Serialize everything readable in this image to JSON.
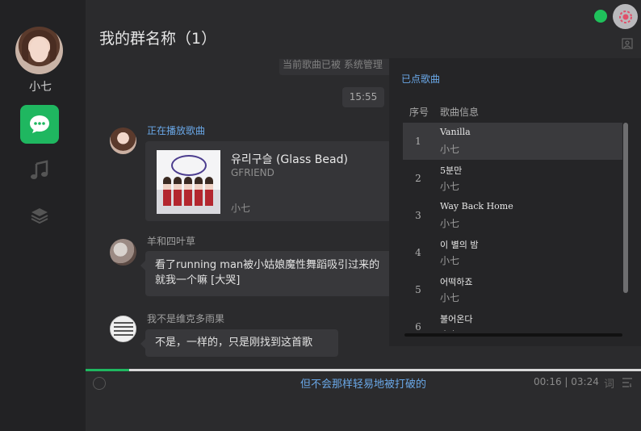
{
  "sidebar": {
    "username": "小七",
    "accent": "#1fb760"
  },
  "header": {
    "title": "我的群名称（1）",
    "online_color": "#1fc15b"
  },
  "chat": {
    "system_notice": "当前歌曲已被 系统管理",
    "time": "15:55",
    "now_playing_label": "正在播放歌曲",
    "now_playing": {
      "title": "유리구슬 (Glass Bead)",
      "artist": "GFRIEND",
      "requested_by": "小七"
    },
    "messages": [
      {
        "sender": "羊和四叶草",
        "text": "看了running man被小姑娘魔性舞蹈吸引过来的就我一个嘛 [大哭]"
      },
      {
        "sender": "我不是维克多雨果",
        "text": "不是，一样的，只是刚找到这首歌"
      }
    ]
  },
  "playlist": {
    "title": "已点歌曲",
    "col_index": "序号",
    "col_info": "歌曲信息",
    "items": [
      {
        "index": "1",
        "name": "Vanilla",
        "user": "小七"
      },
      {
        "index": "2",
        "name": "5분만",
        "user": "小七"
      },
      {
        "index": "3",
        "name": "Way Back Home",
        "user": "小七"
      },
      {
        "index": "4",
        "name": "이 별의 밤",
        "user": "小七"
      },
      {
        "index": "5",
        "name": "어떡하죠",
        "user": "小七"
      },
      {
        "index": "6",
        "name": "불어온다",
        "user": "小七"
      }
    ]
  },
  "player": {
    "lyric": "但不会那样轻易地被打破的",
    "time": "00:16 | 03:24",
    "lyric_button": "词",
    "progress": 0.078
  }
}
